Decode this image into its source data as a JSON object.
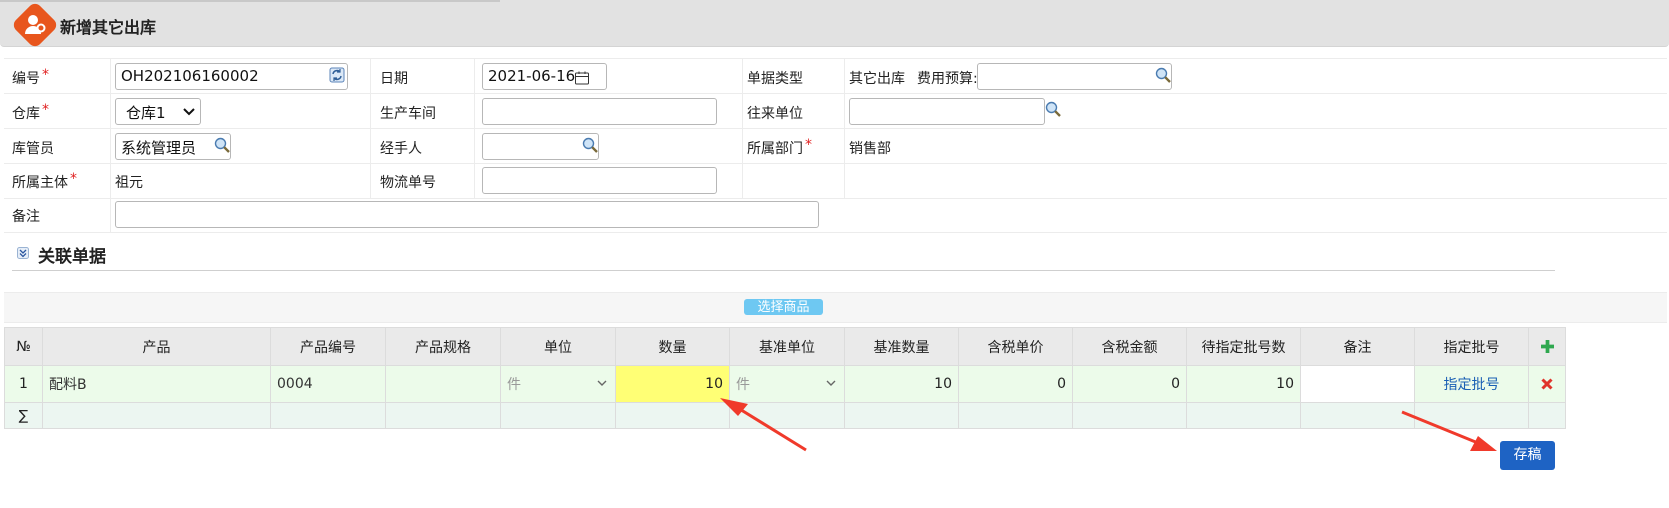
{
  "window": {
    "title": "新增其它出库"
  },
  "form": {
    "code_label": "编号",
    "code_value": "OH202106160002",
    "date_label": "日期",
    "date_value": "2021-06-16",
    "doc_type_label": "单据类型",
    "doc_type_value": "其它出库",
    "budget_label": "费用预算:",
    "budget_value": "",
    "warehouse_label": "仓库",
    "warehouse_value": "仓库1",
    "workshop_label": "生产车间",
    "workshop_value": "",
    "partner_label": "往来单位",
    "partner_value": "",
    "keeper_label": "库管员",
    "keeper_value": "系统管理员",
    "handler_label": "经手人",
    "handler_value": "",
    "dept_label": "所属部门",
    "dept_value": "销售部",
    "entity_label": "所属主体",
    "entity_value": "祖元",
    "tracking_label": "物流单号",
    "tracking_value": "",
    "remark_label": "备注",
    "remark_value": ""
  },
  "section": {
    "title": "关联单据",
    "pick_button": "选择商品"
  },
  "table": {
    "headers": [
      "№",
      "产品",
      "产品编号",
      "产品规格",
      "单位",
      "数量",
      "基准单位",
      "基准数量",
      "含税单价",
      "含税金额",
      "待指定批号数",
      "备注",
      "指定批号"
    ],
    "rows": [
      {
        "no": "1",
        "product": "配料B",
        "code": "0004",
        "spec": "",
        "unit": "件",
        "qty": "10",
        "base_unit": "件",
        "base_qty": "10",
        "price": "0",
        "amount": "0",
        "pending": "10",
        "remark": "",
        "batch_link": "指定批号"
      }
    ],
    "sum_symbol": "∑"
  },
  "toolbar": {
    "save_label": "存稿"
  },
  "colors": {
    "accent": "#1e63c4",
    "highlight": "#ffff75",
    "row_bg": "#ecfbea",
    "icon": "#e8561d",
    "arrow": "#f03a2b"
  }
}
